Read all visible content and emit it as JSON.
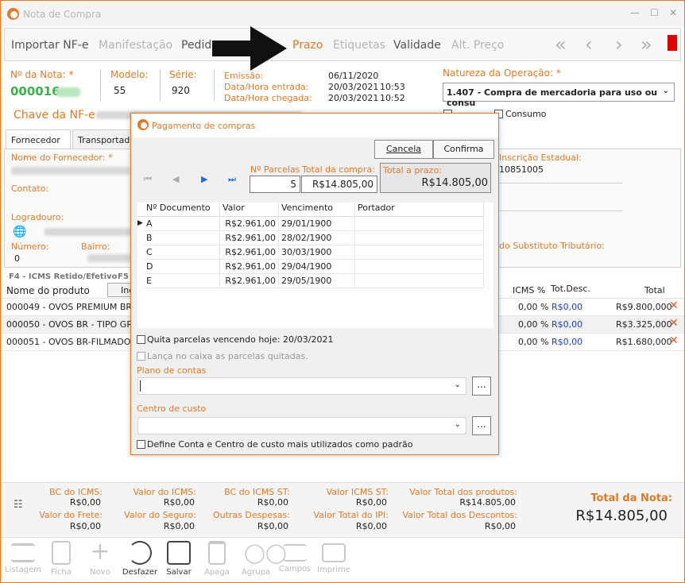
{
  "window": {
    "title": "Nota de Compra"
  },
  "menu": [
    {
      "label": "Importar NF-e",
      "color": "#555555"
    },
    {
      "label": "Manifestação",
      "color": "#b5b5b5"
    },
    {
      "label": "Pedido",
      "color": "#555555"
    },
    {
      "label": "Prazo",
      "color": "#e07a28"
    },
    {
      "label": "Etiquetas",
      "color": "#b5b5b5"
    },
    {
      "label": "Validade",
      "color": "#555555"
    },
    {
      "label": "Alt. Preço",
      "color": "#b5b5b5"
    }
  ],
  "header": {
    "nota_label": "Nº da Nota: *",
    "nota_value": "000016",
    "modelo_label": "Modelo:",
    "modelo_value": "55",
    "serie_label": "Série:",
    "serie_value": "920",
    "emissao_label": "Emissão:",
    "emissao_value": "06/11/2020",
    "entrada_label": "Data/Hora entrada:",
    "entrada_value": "20/03/2021",
    "entrada_time": "10:53",
    "chegada_label": "Data/Hora chegada:",
    "chegada_value": "20/03/2021",
    "chegada_time": "10:52",
    "natureza_label": "Natureza da Operação: *",
    "natureza_value": "1.407 - Compra de mercadoria para uso ou consu",
    "consumo_label": "Consumo",
    "chave_label": "Chave da NF-e"
  },
  "tabs": [
    "Fornecedor",
    "Transportador"
  ],
  "fornecedor": {
    "nome_label": "Nome do Fornecedor: *",
    "contato_label": "Contato:",
    "logradouro_label": "Logradouro:",
    "numero_label": "Número:",
    "numero_value": "0",
    "bairro_label": "Bairro:",
    "ie_label": "Inscrição Estadual:",
    "ie_value": "10851005",
    "subst_label": "do Substituto Tributário:"
  },
  "f4_label": "F4 - ICMS Retido/Efetivo",
  "f5_label": "F5",
  "grid": {
    "headers": {
      "produto": "Nome do produto",
      "icms": "ICMS %",
      "totdesc": "Tot.Desc.",
      "total": "Total",
      "ins_button": "Inc"
    },
    "rows": [
      {
        "produto": "000049 - OVOS PREMIUM BR-T",
        "icms": "0,00 %",
        "desc": "R$0,00",
        "total": "R$9.800,000"
      },
      {
        "produto": "000050 - OVOS BR - TIPO GRAN",
        "icms": "0,00 %",
        "desc": "R$0,00",
        "total": "R$3.325,000"
      },
      {
        "produto": "000051 - OVOS BR-FILMADO G",
        "icms": "0,00 %",
        "desc": "R$0,00",
        "total": "R$1.680,000"
      }
    ]
  },
  "footer": {
    "bc_icms_label": "BC do ICMS:",
    "bc_icms": "R$0,00",
    "v_icms_label": "Valor do ICMS:",
    "v_icms": "R$0,00",
    "bc_st_label": "BC do ICMS ST:",
    "bc_st": "R$0,00",
    "v_st_label": "Valor ICMS ST:",
    "v_st": "R$0,00",
    "v_prod_label": "Valor Total dos produtos:",
    "v_prod": "R$14.805,00",
    "frete_label": "Valor do Frete:",
    "frete": "R$0,00",
    "seguro_label": "Valor do Seguro:",
    "seguro": "R$0,00",
    "outras_label": "Outras Despesas:",
    "outras": "R$0,00",
    "ipi_label": "Valor Total do IPI:",
    "ipi": "R$0,00",
    "desc_label": "Valor Total dos Descontos:",
    "desc": "R$0,00",
    "total_label": "Total da Nota:",
    "total": "R$14.805,00"
  },
  "toolbar": [
    {
      "label": "Listagem",
      "enabled": false
    },
    {
      "label": "Ficha",
      "enabled": false
    },
    {
      "label": "Novo",
      "enabled": false
    },
    {
      "label": "Desfazer",
      "enabled": true
    },
    {
      "label": "Salvar",
      "enabled": true
    },
    {
      "label": "Apaga",
      "enabled": false
    },
    {
      "label": "Agrupa",
      "enabled": false
    },
    {
      "label": "Campos",
      "enabled": false
    },
    {
      "label": "Imprime",
      "enabled": false
    }
  ],
  "dialog": {
    "title": "Pagamento de compras",
    "cancel_label": "Cancela",
    "confirm_label": "Confirma",
    "parcelas_label": "Nº Parcelas",
    "parcelas_value": "5",
    "total_compra_label": "Total da compra:",
    "total_compra_value": "R$14.805,00",
    "total_prazo_label": "Total a prazo:",
    "total_prazo_value": "R$14.805,00",
    "grid_headers": {
      "doc": "Nº Documento",
      "valor": "Valor",
      "venc": "Vencimento",
      "portador": "Portador"
    },
    "rows": [
      {
        "doc": "A",
        "valor": "R$2.961,00",
        "venc": "29/01/1900"
      },
      {
        "doc": "B",
        "valor": "R$2.961,00",
        "venc": "28/02/1900"
      },
      {
        "doc": "C",
        "valor": "R$2.961,00",
        "venc": "30/03/1900"
      },
      {
        "doc": "D",
        "valor": "R$2.961,00",
        "venc": "29/04/1900"
      },
      {
        "doc": "E",
        "valor": "R$2.961,00",
        "venc": "29/05/1900"
      }
    ],
    "quita_label": "Quita parcelas vencendo hoje: 20/03/2021",
    "lanca_label": "Lança no caixa as parcelas quitadas.",
    "plano_label": "Plano de contas",
    "centro_label": "Centro de custo",
    "define_label": "Define Conta e Centro de custo mais utilizados como padrão",
    "dots_label": "..."
  }
}
